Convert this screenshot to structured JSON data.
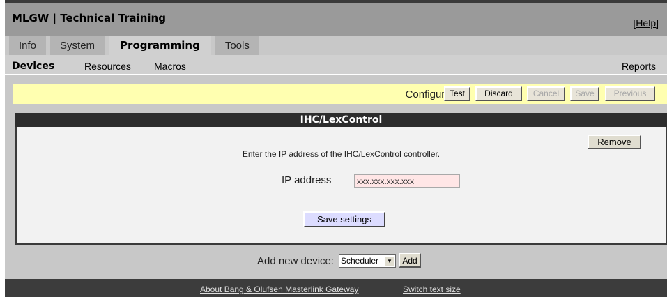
{
  "header": {
    "app_title": "MLGW | Technical Training",
    "help_link": "[Help]"
  },
  "tabs": [
    {
      "label": "Info"
    },
    {
      "label": "System"
    },
    {
      "label": "Programming"
    },
    {
      "label": "Tools"
    }
  ],
  "subnav": {
    "devices": "Devices",
    "resources": "Resources",
    "macros": "Macros",
    "reports": "Reports"
  },
  "config_bar": {
    "label": "Configuration:",
    "test": "Test",
    "discard": "Discard",
    "cancel": "Cancel",
    "save": "Save",
    "previous": "Previous"
  },
  "panel": {
    "title": "IHC/LexControl",
    "remove": "Remove",
    "instructions": "Enter the IP address of the IHC/LexControl controller.",
    "ip_label": "IP address",
    "ip_value": "xxx.xxx.xxx.xxx",
    "save_settings": "Save settings"
  },
  "add_device": {
    "label": "Add new device:",
    "selected": "Scheduler",
    "add": "Add"
  },
  "footer": {
    "about": "About Bang & Olufsen Masterlink Gateway",
    "switch_text": "Switch text size"
  },
  "colors": {
    "config_bar_bg": "#ffffb0",
    "ip_field_bg": "#ffe6e6",
    "save_settings_bg": "#dcdcff",
    "panel_header_bg": "#2d2d2d"
  },
  "icons": {
    "select_arrow": "triangle-down-icon"
  }
}
